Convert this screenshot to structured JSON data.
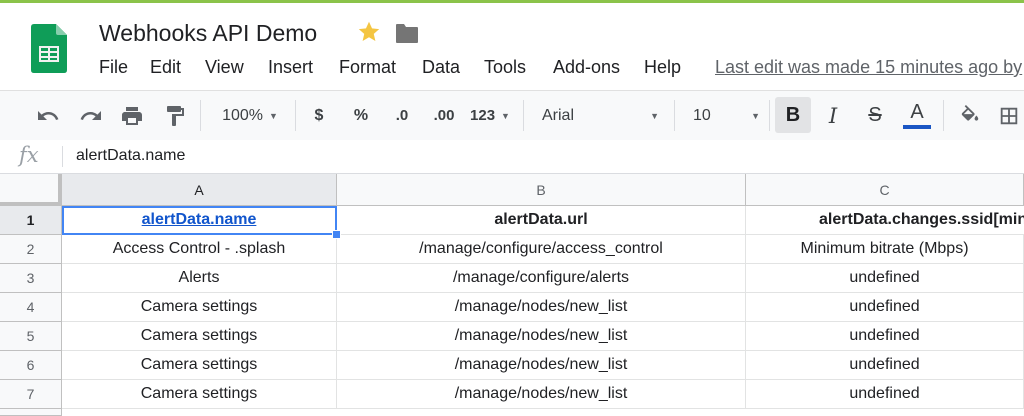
{
  "app": {
    "title": "Webhooks API Demo",
    "menu": [
      "File",
      "Edit",
      "View",
      "Insert",
      "Format",
      "Data",
      "Tools",
      "Add-ons",
      "Help"
    ],
    "last_edit": "Last edit was made 15 minutes ago by"
  },
  "toolbar": {
    "zoom": "100%",
    "currency": "$",
    "percent": "%",
    "decrease_decimal": ".0",
    "increase_decimal": ".00",
    "number_format": "123",
    "font": "Arial",
    "font_size": "10",
    "bold": "B",
    "italic": "I",
    "strikethrough": "S",
    "text_color_label": "A",
    "text_color": "#1a56c4"
  },
  "formula": {
    "fx": "fx",
    "value": "alertData.name"
  },
  "sheet": {
    "columns": [
      "A",
      "B",
      "C"
    ],
    "rows": [
      {
        "num": "1",
        "cells": [
          "alertData.name",
          "alertData.url",
          "alertData.changes.ssid[minBitrate].label"
        ]
      },
      {
        "num": "2",
        "cells": [
          "Access Control - .splash",
          "/manage/configure/access_control",
          "Minimum bitrate (Mbps)"
        ]
      },
      {
        "num": "3",
        "cells": [
          "Alerts",
          "/manage/configure/alerts",
          "undefined"
        ]
      },
      {
        "num": "4",
        "cells": [
          "Camera settings",
          "/manage/nodes/new_list",
          "undefined"
        ]
      },
      {
        "num": "5",
        "cells": [
          "Camera settings",
          "/manage/nodes/new_list",
          "undefined"
        ]
      },
      {
        "num": "6",
        "cells": [
          "Camera settings",
          "/manage/nodes/new_list",
          "undefined"
        ]
      },
      {
        "num": "7",
        "cells": [
          "Camera settings",
          "/manage/nodes/new_list",
          "undefined"
        ]
      }
    ]
  },
  "colors": {
    "brand_green": "#0f9d58",
    "selection_blue": "#4285f4",
    "link_blue": "#1155cc"
  }
}
